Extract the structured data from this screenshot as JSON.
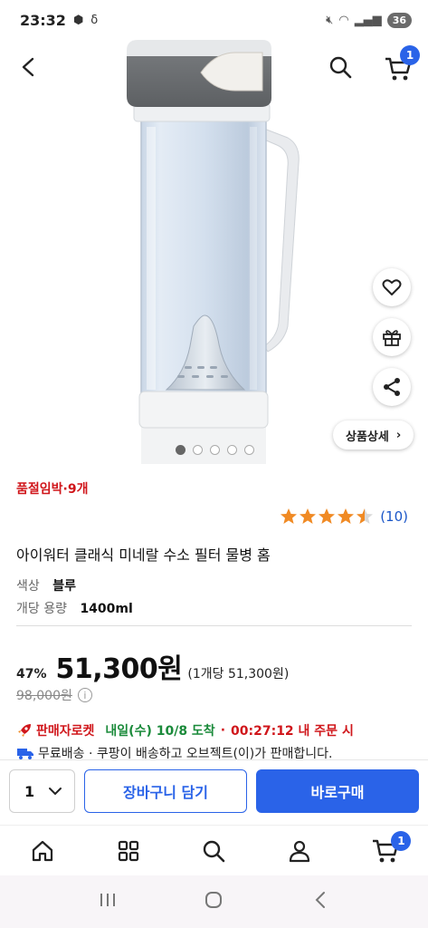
{
  "status_bar": {
    "time": "23:32",
    "battery": "36"
  },
  "header": {
    "cart_count": "1"
  },
  "product_image": {
    "detail_button_label": "상품상세",
    "carousel_dots": 5,
    "active_dot": 0
  },
  "product": {
    "stock_notice": "품절임박·9개",
    "rating": 4.5,
    "review_count": "(10)",
    "title": "아이워터 클래식 미네랄 수소 필터 물병 홈",
    "options": [
      {
        "label": "색상",
        "value": "블루"
      },
      {
        "label": "개당 용량",
        "value": "1400ml"
      }
    ],
    "discount": "47%",
    "price": "51,300원",
    "unit_price": "(1개당 51,300원)",
    "original_price": "98,000원"
  },
  "delivery": {
    "badge": "판매자로켓",
    "arrival": "내일(수) 10/8 도착",
    "separator": "·",
    "countdown": "00:27:12 내 주문 시",
    "shipping_text": "무료배송 · 쿠팡이 배송하고 오브젝트(이)가 판매합니다."
  },
  "purchase_bar": {
    "quantity": "1",
    "add_to_cart": "장바구니 담기",
    "buy_now": "바로구매"
  },
  "bottom_nav": {
    "cart_badge": "1"
  },
  "colors": {
    "accent": "#2a63e8",
    "alert_red": "#d0161b",
    "arrival_green": "#1a8a3a",
    "star": "#f08a24"
  }
}
